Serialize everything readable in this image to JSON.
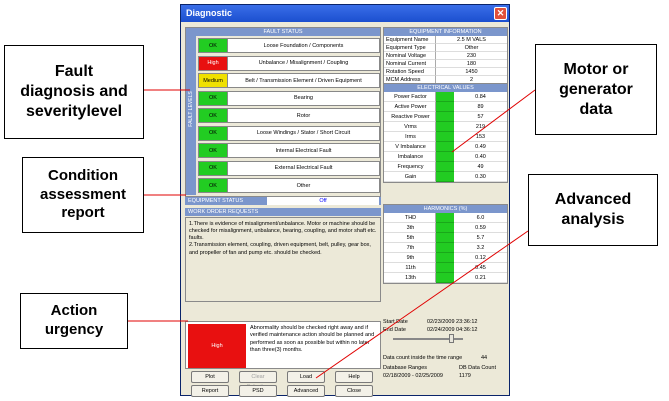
{
  "callouts": {
    "fault": "Fault\ndiagnosis and\nseveritylevel",
    "condition": "Condition\nassessment\nreport",
    "action": "Action\nurgency",
    "motor": "Motor or\ngenerator\ndata",
    "advanced": "Advanced\nanalysis"
  },
  "window": {
    "title": "Diagnostic",
    "close_glyph": "✕"
  },
  "fault_status": {
    "header": "FAULT STATUS",
    "side_label": "FAULT LEVELS",
    "rows": [
      {
        "severity": "OK",
        "name": "Loose Foundation / Components",
        "color": "#22cc22"
      },
      {
        "severity": "High",
        "name": "Unbalance / Misalignment / Coupling",
        "color": "#e81010"
      },
      {
        "severity": "Medium",
        "name": "Belt / Transmission Element / Driven Equipment",
        "color": "#f0e000"
      },
      {
        "severity": "OK",
        "name": "Bearing",
        "color": "#22cc22"
      },
      {
        "severity": "OK",
        "name": "Rotor",
        "color": "#22cc22"
      },
      {
        "severity": "OK",
        "name": "Loose Windings / Stator / Short Circuit",
        "color": "#22cc22"
      },
      {
        "severity": "OK",
        "name": "Internal Electrical Fault",
        "color": "#22cc22"
      },
      {
        "severity": "OK",
        "name": "External Electrical Fault",
        "color": "#22cc22"
      },
      {
        "severity": "OK",
        "name": "Other",
        "color": "#22cc22"
      }
    ]
  },
  "equipment_status": {
    "label": "EQUIPMENT STATUS",
    "value": "Off"
  },
  "work_order": {
    "header": "WORK ORDER REQUESTS",
    "text": "1.There is evidence of misalignment/unbalance. Motor or machine should be checked for misalignment, unbalance, bearing, coupling, and motor shaft etc. faults.\n2.Transmission element, coupling, driven equipment, belt, pulley, gear box, and propeller of fan and pump etc. should be checked."
  },
  "urgency": {
    "level": "High",
    "text": "Abnormality should be checked right away and if verified maintenance action should be planned and performed as soon as possible but within no later than three(3) months."
  },
  "buttons": {
    "plot": "Plot",
    "clear": "Clear Selection",
    "load": "Load",
    "help": "Help",
    "report": "Report",
    "psd": "PSD",
    "advanced": "Advanced",
    "close": "Close"
  },
  "equipment_info": {
    "header": "EQUIPMENT INFORMATION",
    "rows": [
      {
        "k": "Equipment Name",
        "v": "2.5 M VALS"
      },
      {
        "k": "Equipment Type",
        "v": "Other"
      },
      {
        "k": "Nominal Voltage",
        "v": "230"
      },
      {
        "k": "Nominal Current",
        "v": "180"
      },
      {
        "k": "Rotation Speed",
        "v": "1450"
      },
      {
        "k": "MCM Address",
        "v": "2"
      }
    ]
  },
  "electrical_values": {
    "header": "ELECTRICAL VALUES",
    "rows": [
      {
        "k": "Power Factor",
        "v": "0.84"
      },
      {
        "k": "Active Power",
        "v": "89"
      },
      {
        "k": "Reactive Power",
        "v": "57"
      },
      {
        "k": "Vrms",
        "v": "219"
      },
      {
        "k": "Irms",
        "v": "153"
      },
      {
        "k": "V Imbalance",
        "v": "0.49"
      },
      {
        "k": "Imbalance",
        "v": "0.40"
      },
      {
        "k": "Frequency",
        "v": "49"
      },
      {
        "k": "Gain",
        "v": "0.30"
      }
    ]
  },
  "harmonics": {
    "header": "HARMONICS (%)",
    "rows": [
      {
        "k": "THD",
        "v": "6.0"
      },
      {
        "k": "3th",
        "v": "0.59"
      },
      {
        "k": "5th",
        "v": "5.7"
      },
      {
        "k": "7th",
        "v": "3.2"
      },
      {
        "k": "9th",
        "v": "0.12"
      },
      {
        "k": "11th",
        "v": "0.45"
      },
      {
        "k": "13th",
        "v": "0.21"
      }
    ]
  },
  "dates": {
    "start_label": "Start Date",
    "start_value": "02/23/2009 23:36:12",
    "end_label": "End Date",
    "end_value": "02/24/2009 04:36:12",
    "count_label": "Data count inside the time range",
    "count_value": "44",
    "db_ranges_label": "Database Ranges",
    "db_count_label": "DB Data Count",
    "db_range": "02/18/2009 - 02/25/2009",
    "db_count": "1179"
  }
}
